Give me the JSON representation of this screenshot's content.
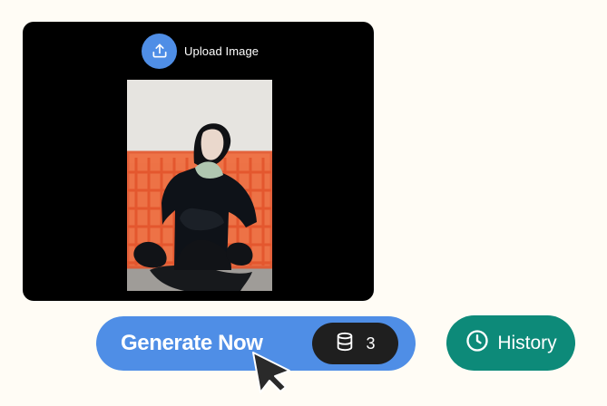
{
  "upload": {
    "label": "Upload Image",
    "icon": "upload-icon"
  },
  "photo": {
    "description_icon": "uploaded-photo"
  },
  "actions": {
    "generate_label": "Generate Now",
    "credits_icon": "database-icon",
    "credits_count": "3",
    "history_label": "History",
    "history_icon": "clock-icon"
  },
  "colors": {
    "page_bg": "#fffcf5",
    "panel_bg": "#000000",
    "primary": "#4f8ee6",
    "history": "#0d8a79",
    "credits_bg": "#1f1f1f"
  }
}
